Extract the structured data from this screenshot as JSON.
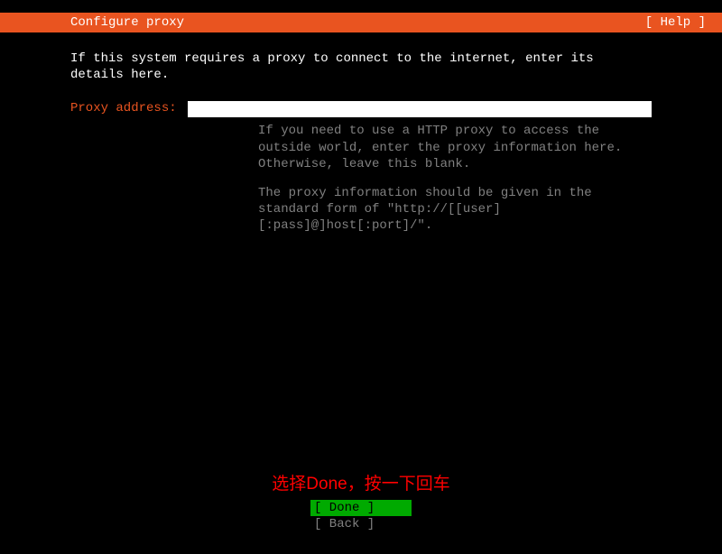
{
  "header": {
    "title": "Configure proxy",
    "help": "[ Help ]"
  },
  "intro": "If this system requires a proxy to connect to the internet, enter its details here.",
  "form": {
    "label": "Proxy address:",
    "value": "",
    "help1": "If you need to use a HTTP proxy to access the outside world, enter the proxy information here. Otherwise, leave this blank.",
    "help2": "The proxy information should be given in the standard form of \"http://[[user][:pass]@]host[:port]/\"."
  },
  "annotation": "选择Done，按一下回车",
  "buttons": {
    "done": "[ Done       ]",
    "back": "[ Back       ]"
  }
}
